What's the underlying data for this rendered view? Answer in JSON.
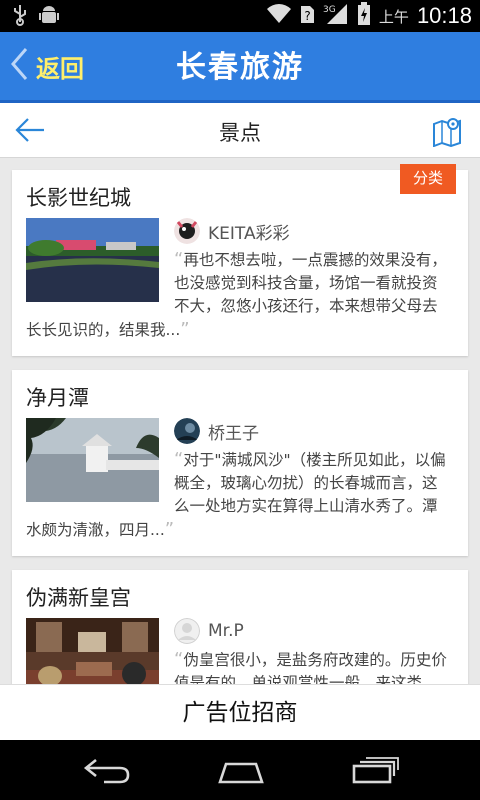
{
  "status_bar": {
    "ampm": "上午",
    "time": "10:18",
    "icons": [
      "usb-icon",
      "android-debug-icon",
      "wifi-icon",
      "sim-unknown-icon",
      "3g-signal-icon",
      "battery-charging-icon"
    ]
  },
  "header": {
    "back_label": "返回",
    "title": "长春旅游"
  },
  "subnav": {
    "title": "景点"
  },
  "tag_label": "分类",
  "cards": [
    {
      "title": "长影世纪城",
      "reviewer": "KEITA彩彩",
      "review": "再也不想去啦，一点震撼的效果没有，也没感觉到科技含量，场馆一看就投资不大，忽悠小孩还行，本来想带父母去长长见识的，结果我..."
    },
    {
      "title": "净月潭",
      "reviewer": "桥王子",
      "review": "对于\"满城风沙\"（楼主所见如此，以偏概全，玻璃心勿扰）的长春城而言，这么一处地方实在算得上山清水秀了。潭水颇为清澈，四月..."
    },
    {
      "title": "伪满新皇宫",
      "reviewer": "Mr.P",
      "review": "伪皇宫很小，是盐务府改建的。历史价值是有的，单说观赏性一般。来这类"
    }
  ],
  "ad": {
    "label": "广告位招商"
  },
  "colors": {
    "header_blue": "#2f7ee0",
    "back_yellow": "#ffef6b",
    "tag_orange": "#f05a22"
  }
}
